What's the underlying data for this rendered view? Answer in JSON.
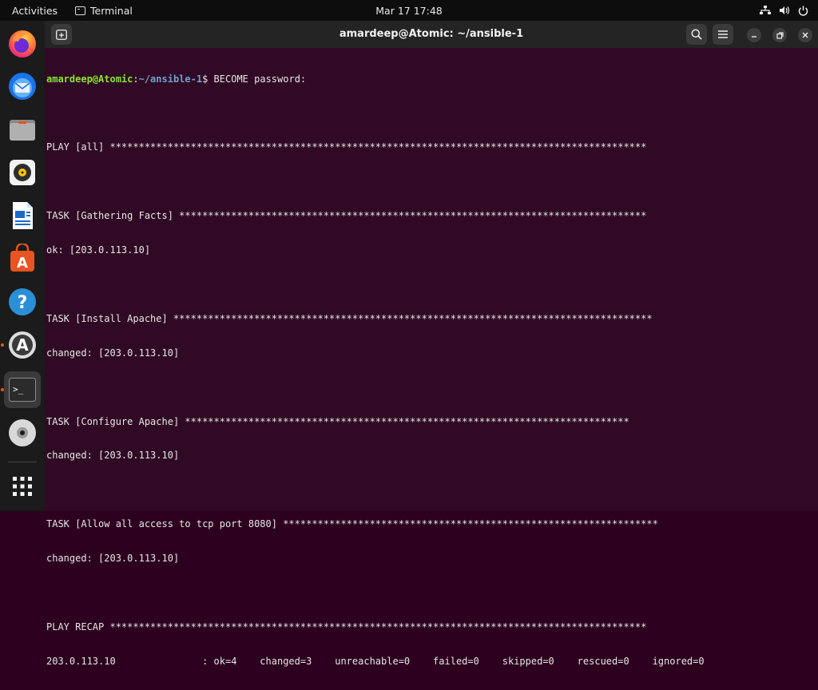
{
  "topbar": {
    "activities": "Activities",
    "app_name": "Terminal",
    "clock": "Mar 17  17:48"
  },
  "dock": {
    "items": [
      {
        "name": "firefox-icon"
      },
      {
        "name": "thunderbird-icon"
      },
      {
        "name": "files-icon"
      },
      {
        "name": "rhythmbox-icon"
      },
      {
        "name": "libreoffice-writer-icon"
      },
      {
        "name": "app-center-icon"
      },
      {
        "name": "help-icon"
      },
      {
        "name": "software-updater-icon"
      },
      {
        "name": "terminal-icon"
      },
      {
        "name": "disc-icon"
      },
      {
        "name": "show-apps-icon"
      }
    ],
    "accent": "#e95420"
  },
  "window": {
    "title": "amardeep@Atomic: ~/ansible-1"
  },
  "terminal": {
    "prompt_user": "amardeep@Atomic",
    "prompt_sep": ":",
    "prompt_path": "~/ansible-1",
    "prompt_tail": "$ BECOME password:",
    "lines": [
      "",
      "PLAY [all] *********************************************************************************************",
      "",
      "TASK [Gathering Facts] *********************************************************************************",
      "ok: [203.0.113.10]",
      "",
      "TASK [Install Apache] ***********************************************************************************",
      "changed: [203.0.113.10]",
      "",
      "TASK [Configure Apache] *****************************************************************************",
      "changed: [203.0.113.10]",
      "",
      "TASK [Allow all access to tcp port 8080] *****************************************************************",
      "changed: [203.0.113.10]",
      "",
      "PLAY RECAP *********************************************************************************************",
      "203.0.113.10               : ok=4    changed=3    unreachable=0    failed=0    skipped=0    rescued=0    ignored=0"
    ],
    "colors": {
      "background": "#300a24",
      "text": "#e6e6e6",
      "user": "#8ae234",
      "path": "#729fcf"
    }
  }
}
